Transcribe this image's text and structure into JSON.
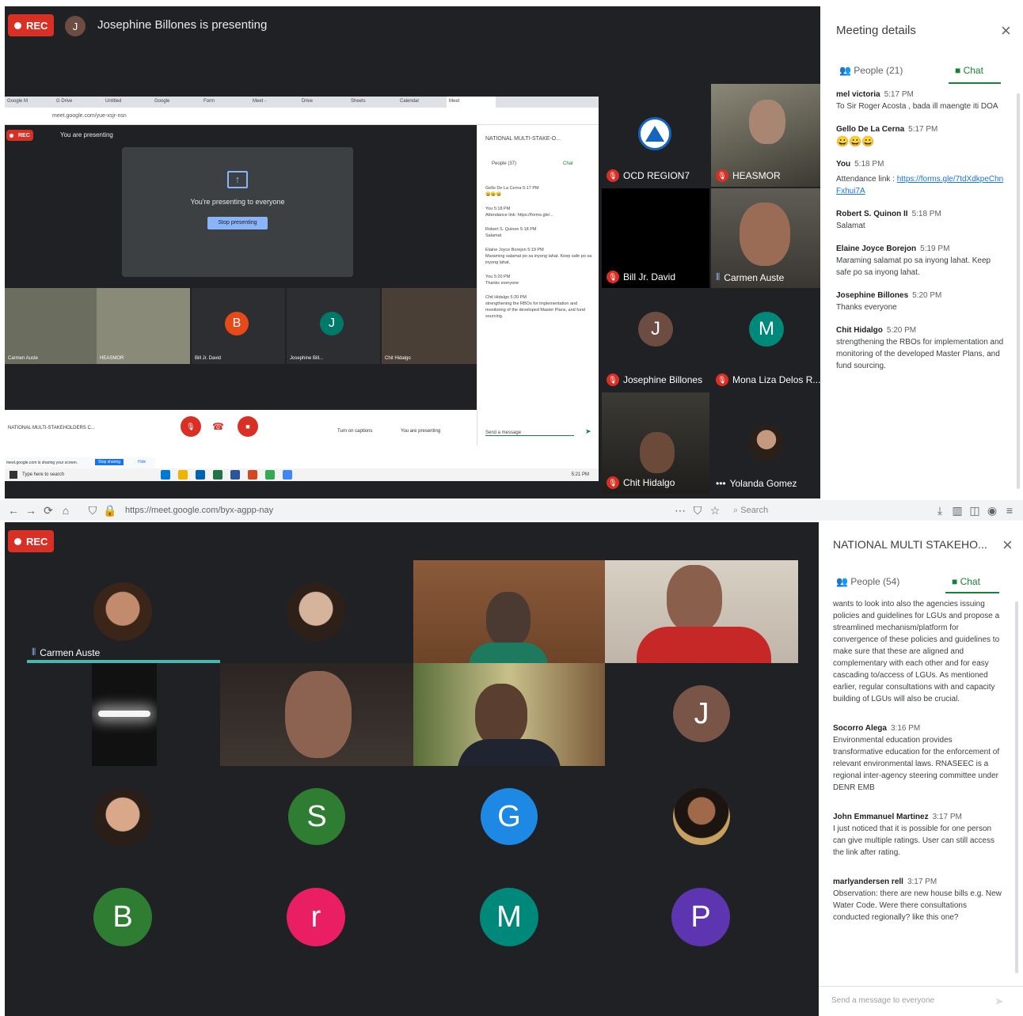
{
  "top": {
    "rec_label": "REC",
    "presenter_initial": "J",
    "presenter_text": "Josephine Billones is presenting",
    "inner": {
      "tabs": [
        "Google M",
        "G Drive",
        "Untitled",
        "Google",
        "Form",
        "Meet - ",
        "Drive",
        "Sheets",
        "Calendar",
        "Meet"
      ],
      "address": "meet.google.com/yue-xsjr-nsn",
      "rec_label": "REC",
      "presenting_label": "You are presenting",
      "presenting_card": "You're presenting to everyone",
      "stop_button": "Stop presenting",
      "panel_title": "NATIONAL MULTI-STAKE-O...",
      "people_tab": "People (37)",
      "chat_tab": "Chat",
      "chat": [
        {
          "sender": "Gello De La Cerna",
          "time": "5:17 PM",
          "text": "😀😀😀"
        },
        {
          "sender": "You",
          "time": "5:18 PM",
          "text": "Attendance link: https://forms.gle/..."
        },
        {
          "sender": "Robert S. Quinon",
          "time": "5:18 PM",
          "text": "Salamat"
        },
        {
          "sender": "Elaine Joyce Borejon",
          "time": "5:19 PM",
          "text": "Maraming salamat po sa inyong lahat. Keep safe po sa inyong lahat."
        },
        {
          "sender": "You",
          "time": "5:20 PM",
          "text": "Thanks everyone"
        },
        {
          "sender": "Chit Hidalgo",
          "time": "5:20 PM",
          "text": "strengthening the RBOs for implementation and monitoring of the developed Master Plans, and fund sourcing."
        }
      ],
      "chat_input": "Send a message",
      "thumbs": [
        "Carmen Auste",
        "HEASMOR",
        "Bill Jr. David",
        "Josephine Bill...",
        "Chit Hidalgo"
      ],
      "thumb_initials": [
        "B",
        "J"
      ],
      "meeting_name": "NATIONAL MULTI-STAKEHOLDERS C...",
      "turn_on_captions": "Turn on captions",
      "present_now": "You are presenting",
      "notification": "meet.google.com is sharing your screen.",
      "stop_sharing": "Stop sharing",
      "hide": "Hide",
      "search": "Type here to search",
      "clock": "5:21 PM"
    },
    "tiles": [
      {
        "name": "OCD REGION7",
        "type": "logo"
      },
      {
        "name": "HEASMOR",
        "type": "video"
      },
      {
        "name": "Bill Jr. David",
        "type": "blank"
      },
      {
        "name": "Carmen Auste",
        "type": "video"
      },
      {
        "name": "Josephine Billones",
        "type": "initial",
        "initial": "J",
        "color": "#6d4c41"
      },
      {
        "name": "Mona Liza Delos R...",
        "type": "initial",
        "initial": "M",
        "color": "#00897b"
      },
      {
        "name": "Chit Hidalgo",
        "type": "video"
      },
      {
        "name": "Yolanda Gomez",
        "type": "photo"
      }
    ],
    "panel": {
      "title": "Meeting details",
      "people_tab": "People (21)",
      "chat_tab": "Chat",
      "messages": [
        {
          "sender": "mel victoria",
          "time": "5:17 PM",
          "text": "To Sir Roger Acosta , bada ill maengte iti DOA"
        },
        {
          "sender": "Gello De La Cerna",
          "time": "5:17 PM",
          "text": "😀😀😀"
        },
        {
          "sender": "You",
          "time": "5:18 PM",
          "text": ""
        },
        {
          "sender": "",
          "time": "",
          "text": "Attendance link : ",
          "link": "https://forms.gle/7tdXdkpeChnFxhui7A"
        },
        {
          "sender": "Robert S. Quinon II",
          "time": "5:18 PM",
          "text": "Salamat"
        },
        {
          "sender": "Elaine Joyce Borejon",
          "time": "5:19 PM",
          "text": "Maraming salamat po sa inyong lahat. Keep safe po sa inyong lahat."
        },
        {
          "sender": "Josephine Billones",
          "time": "5:20 PM",
          "text": "Thanks everyone"
        },
        {
          "sender": "Chit Hidalgo",
          "time": "5:20 PM",
          "text": "strengthening the RBOs for implementation and monitoring of the developed Master Plans, and fund sourcing."
        }
      ]
    }
  },
  "browser": {
    "address": "https://meet.google.com/byx-agpp-nay",
    "search_placeholder": "Search"
  },
  "bottom": {
    "rec_label": "REC",
    "tiles": [
      {
        "name": "Carmen Auste",
        "type": "photo"
      },
      {
        "name": "",
        "type": "photo"
      },
      {
        "name": "",
        "type": "video"
      },
      {
        "name": "",
        "type": "video"
      },
      {
        "name": "",
        "type": "light"
      },
      {
        "name": "",
        "type": "video"
      },
      {
        "name": "",
        "type": "video"
      },
      {
        "name": "",
        "type": "initial",
        "initial": "J",
        "color": "#795548"
      },
      {
        "name": "",
        "type": "photo"
      },
      {
        "name": "",
        "type": "initial",
        "initial": "S",
        "color": "#2e7d32"
      },
      {
        "name": "",
        "type": "initial",
        "initial": "G",
        "color": "#1e88e5"
      },
      {
        "name": "",
        "type": "photo"
      },
      {
        "name": "",
        "type": "initial",
        "initial": "B",
        "color": "#2e7d32"
      },
      {
        "name": "",
        "type": "initial",
        "initial": "r",
        "color": "#e91e63"
      },
      {
        "name": "",
        "type": "initial",
        "initial": "M",
        "color": "#00897b"
      },
      {
        "name": "",
        "type": "initial",
        "initial": "P",
        "color": "#5e35b1"
      }
    ],
    "panel": {
      "title": "NATIONAL MULTI STAKEHO...",
      "people_tab": "People (54)",
      "chat_tab": "Chat",
      "messages": [
        {
          "sender": "",
          "time": "",
          "text": "wants to look into also the agencies issuing policies and guidelines for LGUs and propose a streamlined mechanism/platform for convergence of these policies and guidelines to make sure that these are aligned and complementary with each other and for easy cascading to/access of LGUs. As mentioned earlier, regular consultations with and capacity building of LGUs will also be crucial."
        },
        {
          "sender": "Socorro Alega",
          "time": "3:16 PM",
          "text": "Environmental education provides transformative education for the enforcement of relevant environmental laws. RNASEEC is a regional inter-agency steering committee under DENR EMB"
        },
        {
          "sender": "John Emmanuel Martinez",
          "time": "3:17 PM",
          "text": "I just noticed that it is possible for one person can give multiple ratings. User can still access the link after rating."
        },
        {
          "sender": "marlyandersen rell",
          "time": "3:17 PM",
          "text": "Observation: there are new house bills e.g. New Water Code. Were there consultations conducted regionally? like this one?"
        }
      ],
      "input_placeholder": "Send a message to everyone"
    }
  },
  "colors": {
    "stage": "#202124",
    "rec": "#d93025",
    "accent": "#188038",
    "link": "#1a73e8"
  }
}
